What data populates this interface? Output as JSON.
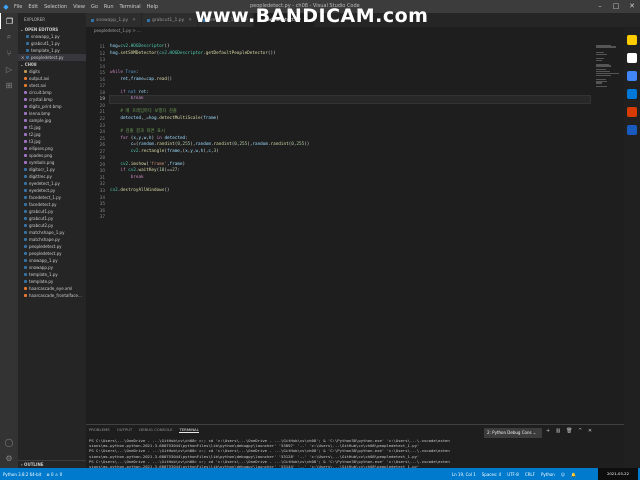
{
  "watermark": "www.BANDICAM.com",
  "titlebar": {
    "menu": [
      "File",
      "Edit",
      "Selection",
      "View",
      "Go",
      "Run",
      "Terminal",
      "Help"
    ],
    "title": "peopledetect.py - ch08 - Visual Studio Code"
  },
  "sidebar": {
    "title": "EXPLORER",
    "open_editors_label": "OPEN EDITORS",
    "open_editors": [
      {
        "name": "snowapp_1.py",
        "selected": false
      },
      {
        "name": "grabcut1_1.py",
        "selected": false
      },
      {
        "name": "template_1.py",
        "selected": false
      },
      {
        "name": "peopledetect.py",
        "selected": true
      }
    ],
    "folder_label": "CH08",
    "files": [
      {
        "name": "digits",
        "color": "#c09553"
      },
      {
        "name": "output.avi",
        "color": "#e37933"
      },
      {
        "name": "vtest.avi",
        "color": "#e37933"
      },
      {
        "name": "circuit.bmp",
        "color": "#a074c4"
      },
      {
        "name": "crystal.bmp",
        "color": "#a074c4"
      },
      {
        "name": "digits_print.bmp",
        "color": "#a074c4"
      },
      {
        "name": "lenna.bmp",
        "color": "#a074c4"
      },
      {
        "name": "sample.jpg",
        "color": "#a074c4"
      },
      {
        "name": "t1.jpg",
        "color": "#a074c4"
      },
      {
        "name": "t2.jpg",
        "color": "#a074c4"
      },
      {
        "name": "t3.jpg",
        "color": "#a074c4"
      },
      {
        "name": "ellipses.png",
        "color": "#a074c4"
      },
      {
        "name": "spades.png",
        "color": "#a074c4"
      },
      {
        "name": "symbols.png",
        "color": "#a074c4"
      },
      {
        "name": "digitocr_1.py",
        "color": "#3572a5"
      },
      {
        "name": "digittrec.py",
        "color": "#3572a5"
      },
      {
        "name": "eyedetect_1.py",
        "color": "#3572a5"
      },
      {
        "name": "eyedetect.py",
        "color": "#3572a5"
      },
      {
        "name": "facedetect_1.py",
        "color": "#3572a5"
      },
      {
        "name": "facedetect.py",
        "color": "#3572a5"
      },
      {
        "name": "grabcut1.py",
        "color": "#3572a5"
      },
      {
        "name": "grabcut1.py",
        "color": "#3572a5"
      },
      {
        "name": "grabcut2.py",
        "color": "#3572a5"
      },
      {
        "name": "matchshape_1.py",
        "color": "#3572a5"
      },
      {
        "name": "matchshape.py",
        "color": "#3572a5"
      },
      {
        "name": "peopledetect.py",
        "color": "#3572a5"
      },
      {
        "name": "peopledetect.py",
        "color": "#3572a5"
      },
      {
        "name": "snowapp_1.py",
        "color": "#3572a5"
      },
      {
        "name": "snowapp.py",
        "color": "#3572a5"
      },
      {
        "name": "template_1.py",
        "color": "#3572a5"
      },
      {
        "name": "template.py",
        "color": "#3572a5"
      },
      {
        "name": "haarcascade_eye.xml",
        "color": "#e37933"
      },
      {
        "name": "haarcascade_frontalface...",
        "color": "#e37933"
      }
    ],
    "outline_label": "OUTLINE"
  },
  "tabs": [
    {
      "label": "snowapp_1.py",
      "active": false
    },
    {
      "label": "grabcut1_1.py",
      "active": false
    },
    {
      "label": "template_1.py",
      "active": false
    },
    {
      "label": "peopledetect.py",
      "active": true
    }
  ],
  "breadcrumb": "peopledetect_1.py > ...",
  "editor": {
    "line_numbers": [
      "11",
      "12",
      "13",
      "14",
      "15",
      "16",
      "17",
      "18",
      "19",
      "20",
      "21",
      "22",
      "23",
      "24",
      "25",
      "26",
      "27",
      "28",
      "29",
      "30",
      "31",
      "32",
      "33",
      "34",
      "35",
      "36",
      "37"
    ],
    "current_line": "19"
  },
  "panel": {
    "tabs": [
      "PROBLEMS",
      "OUTPUT",
      "DEBUG CONSOLE",
      "TERMINAL"
    ],
    "active_tab": "TERMINAL",
    "dropdown": "2: Python Debug Cons",
    "terminal": [
      "PS C:\\Users\\...\\OneDrive - ...\\GitHub\\cv\\ch08> c:; cd 'c:\\Users\\...\\OneDrive - ...\\GitHub\\cv\\ch08'; & 'C:\\Python38\\python.exe' 'c:\\Users\\...\\.vscode\\exten",
      "sions\\ms-python.python-2021.3.680753044\\pythonFiles\\lib\\python\\debugpy\\launcher' '53897' '--' 'c:\\Users\\...\\GitHub\\cv\\ch08\\peopledetect_1.py'",
      "PS C:\\Users\\...\\OneDrive - ...\\GitHub\\cv\\ch08> c:; cd 'c:\\Users\\...\\OneDrive - ...\\GitHub\\cv\\ch08'; & 'C:\\Python38\\python.exe' 'c:\\Users\\...\\.vscode\\exten",
      "sions\\ms-python.python-2021.3.680753044\\pythonFiles\\lib\\python\\debugpy\\launcher' '53128' '--' 'c:\\Users\\...\\GitHub\\cv\\ch08\\peopledetect_1.py'",
      "PS C:\\Users\\...\\OneDrive - ...\\GitHub\\cv\\ch08> c:; cd 'c:\\Users\\...\\OneDrive - ...\\GitHub\\cv\\ch08'; & 'C:\\Python38\\python.exe' 'c:\\Users\\...\\.vscode\\exten",
      "sions\\ms-python.python-2021.3.680753044\\pythonFiles\\lib\\python\\debugpy\\launcher' '53144' '--' 'c:\\Users\\...\\GitHub\\cv\\ch08\\peopledetect_1.py'",
      "PS C:\\Users\\...\\OneDrive - ...\\GitHub\\cv\\ch08> "
    ]
  },
  "statusbar": {
    "python": "Python 3.8.2 64-bit",
    "errors": "⊗ 0 ⚠ 0",
    "position": "Ln 19, Col 1",
    "spaces": "Spaces: 4",
    "encoding": "UTF-8",
    "eol": "CRLF",
    "language": "Python",
    "clock": "2021-03-22"
  },
  "colors": {
    "accent": "#007acc",
    "editor_bg": "#1e1e1e",
    "sidebar_bg": "#252526"
  }
}
